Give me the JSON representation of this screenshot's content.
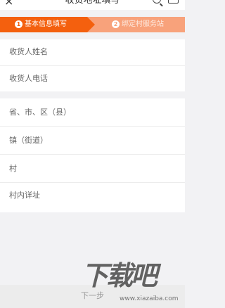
{
  "header": {
    "back_icon": "×",
    "title": "收货地址填写",
    "search_icon": "search-icon",
    "cart_icon": "cart-icon"
  },
  "steps": [
    {
      "num": "1",
      "label": "基本信息填写",
      "active": true,
      "color": "#f4600e"
    },
    {
      "num": "2",
      "label": "绑定村服务站",
      "active": false,
      "color": "#f8a27b"
    }
  ],
  "contact_fields": [
    {
      "label": "收货人姓名"
    },
    {
      "label": "收货人电话"
    }
  ],
  "address_fields": [
    {
      "label": "省、市、区（县）"
    },
    {
      "label": "镇（街道）"
    },
    {
      "label": "村"
    },
    {
      "label": "村内详址"
    }
  ],
  "next_button": {
    "label": "下一步"
  },
  "watermark": {
    "text": "下载吧",
    "url": "www.xiazaiba.com"
  }
}
